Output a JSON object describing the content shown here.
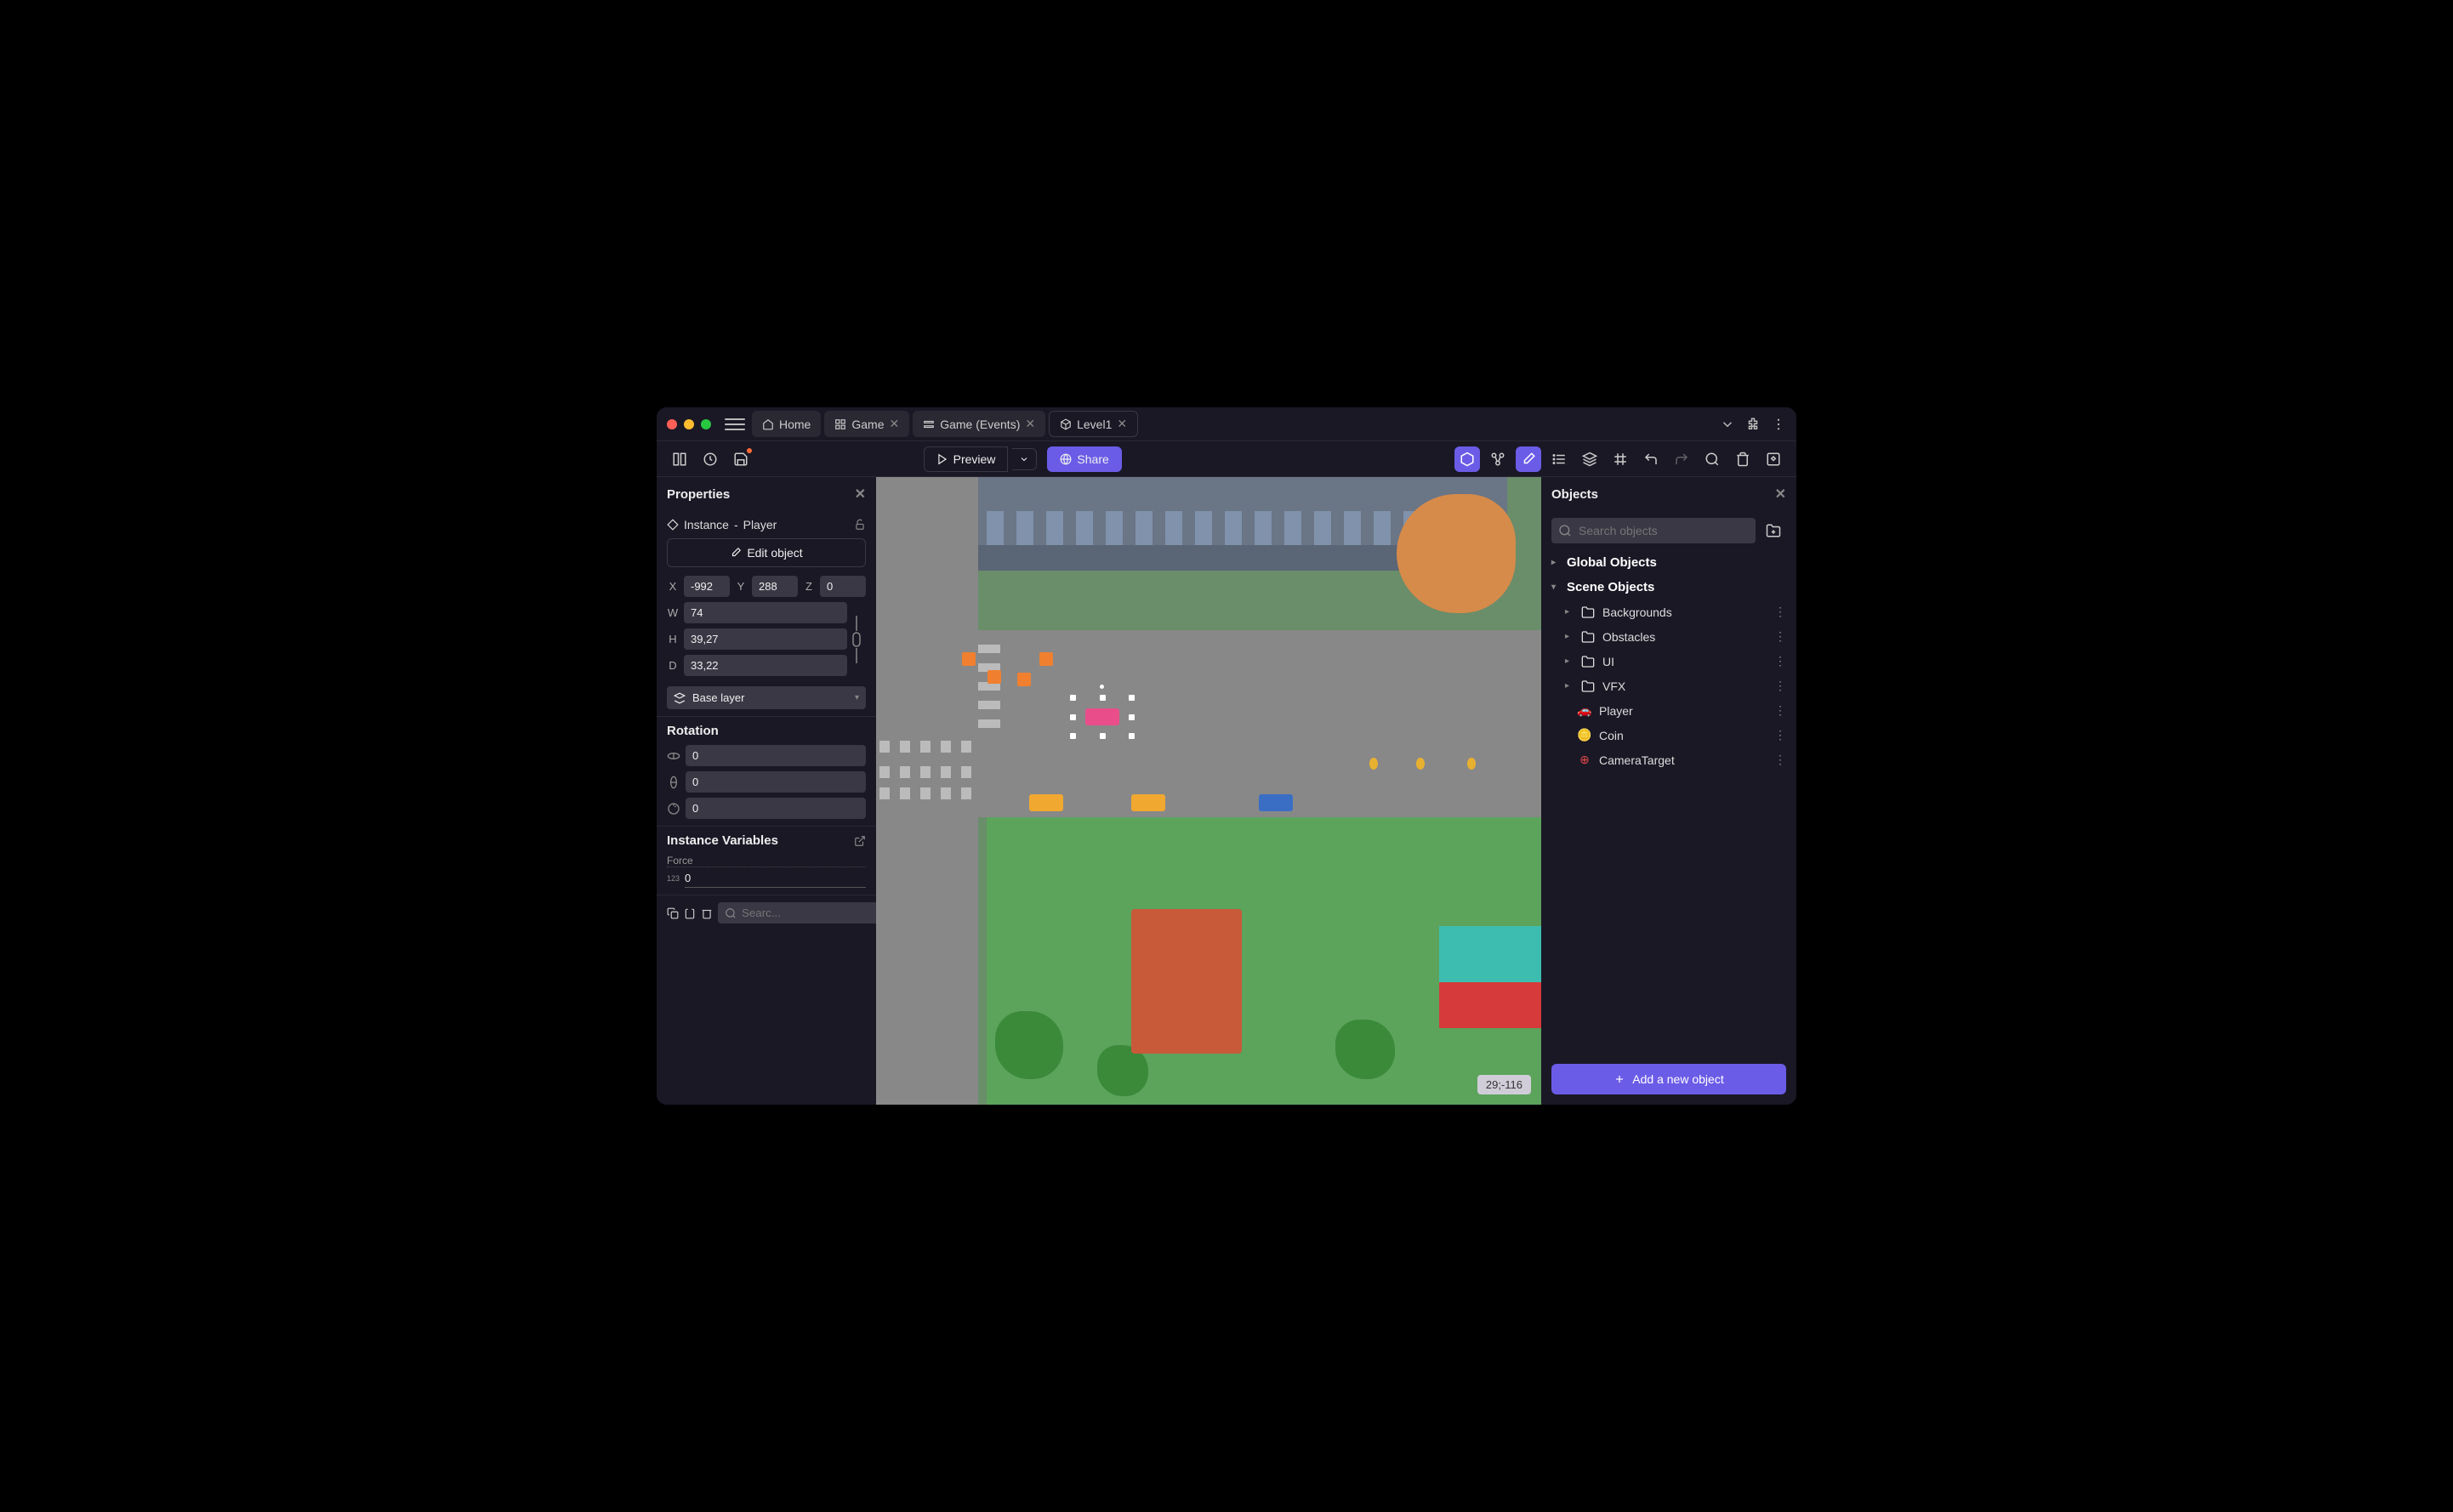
{
  "tabs": [
    {
      "label": "Home",
      "icon": "home"
    },
    {
      "label": "Game",
      "icon": "grid",
      "closable": true
    },
    {
      "label": "Game (Events)",
      "icon": "events",
      "closable": true
    },
    {
      "label": "Level1",
      "icon": "cube",
      "closable": true,
      "active": true
    }
  ],
  "toolbar": {
    "preview_label": "Preview",
    "share_label": "Share"
  },
  "properties": {
    "title": "Properties",
    "instance_label": "Instance",
    "separator": "-",
    "object_name": "Player",
    "edit_object_label": "Edit object",
    "position": {
      "x": "-992",
      "y": "288",
      "z": "0"
    },
    "dimensions": {
      "w": "74",
      "h": "39,27",
      "d": "33,22"
    },
    "layer": "Base layer",
    "rotation_title": "Rotation",
    "rotation": {
      "rx": "0",
      "ry": "0",
      "rz": "0"
    },
    "instance_vars_title": "Instance Variables",
    "vars": [
      {
        "name": "Force",
        "value": "0",
        "type": "123"
      }
    ],
    "search_placeholder": "Searc..."
  },
  "viewport": {
    "coords": "29;-116"
  },
  "objects": {
    "title": "Objects",
    "search_placeholder": "Search objects",
    "groups": [
      {
        "label": "Global Objects",
        "expanded": false
      },
      {
        "label": "Scene Objects",
        "expanded": true,
        "children": [
          {
            "label": "Backgrounds",
            "type": "folder"
          },
          {
            "label": "Obstacles",
            "type": "folder"
          },
          {
            "label": "UI",
            "type": "folder"
          },
          {
            "label": "VFX",
            "type": "folder"
          },
          {
            "label": "Player",
            "type": "object",
            "icon": "car"
          },
          {
            "label": "Coin",
            "type": "object",
            "icon": "coin"
          },
          {
            "label": "CameraTarget",
            "type": "object",
            "icon": "target"
          }
        ]
      }
    ],
    "add_button_label": "Add a new object"
  }
}
